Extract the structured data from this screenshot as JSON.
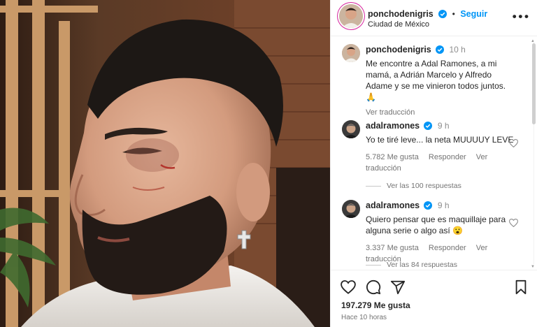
{
  "post": {
    "username": "ponchodenigris",
    "follow_label": "Seguir",
    "location": "Ciudad de México",
    "caption_time": "10 h",
    "caption": "Me encontre a Adal Ramones, a mi mamá, a Adrián Marcelo y Alfredo Adame y se me vinieron todos juntos.",
    "caption_emoji": "🙏",
    "see_translation": "Ver traducción",
    "likes": "197.279 Me gusta",
    "posted_ago": "Hace 10 horas",
    "more_icon": "more-icon"
  },
  "comments": [
    {
      "username": "adalramones",
      "time": "9 h",
      "text": "Yo te tiré leve... la neta MUUUUY LEVE",
      "likes": "5.782 Me gusta",
      "reply_label": "Responder",
      "translate_label": "Ver traducción",
      "replies_label": "Ver las 100 respuestas"
    },
    {
      "username": "adalramones",
      "time": "9 h",
      "text": "Quiero pensar que es maquillaje para alguna serie o algo así 😮",
      "likes": "3.337 Me gusta",
      "reply_label": "Responder",
      "translate_label": "Ver traducción",
      "replies_label": "Ver las 84 respuestas"
    }
  ],
  "icons": {
    "like": "heart-icon",
    "comment": "comment-icon",
    "share": "send-icon",
    "save": "bookmark-icon",
    "verified": "verified-badge-icon"
  },
  "colors": {
    "accent": "#0095f6",
    "text": "#262626",
    "muted": "#737373",
    "verified": "#0095f6"
  }
}
